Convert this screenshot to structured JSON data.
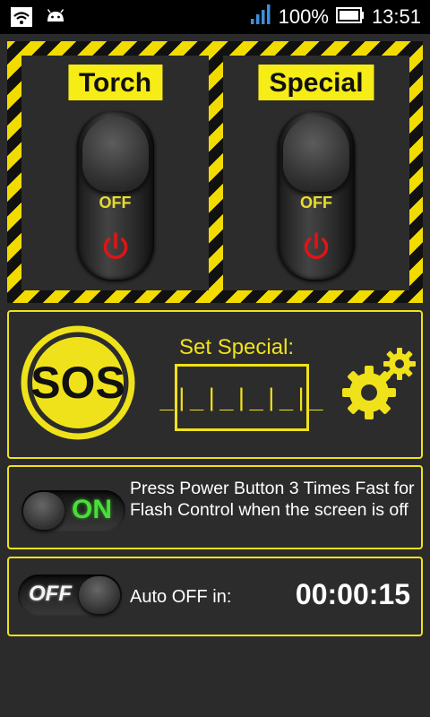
{
  "status_bar": {
    "battery_percent": "100%",
    "time": "13:51",
    "icons": [
      "wifi-icon",
      "android-icon",
      "signal-icon",
      "battery-icon"
    ]
  },
  "torch": {
    "label": "Torch",
    "state": "OFF"
  },
  "special": {
    "label": "Special",
    "state": "OFF"
  },
  "sos": {
    "label": "SOS"
  },
  "set_special": {
    "label": "Set Special:",
    "code": "_|_|_|_|_|_"
  },
  "power_button": {
    "switch_label": "ON",
    "description": "Press Power Button 3 Times Fast for Flash Control when the screen is off"
  },
  "auto_off": {
    "switch_label": "OFF",
    "label": "Auto OFF in:",
    "time": "00:00:15"
  },
  "colors": {
    "accent": "#f0e21a",
    "on_green": "#4bdc3a",
    "power_red": "#e01414",
    "background": "#2b2b2b"
  }
}
